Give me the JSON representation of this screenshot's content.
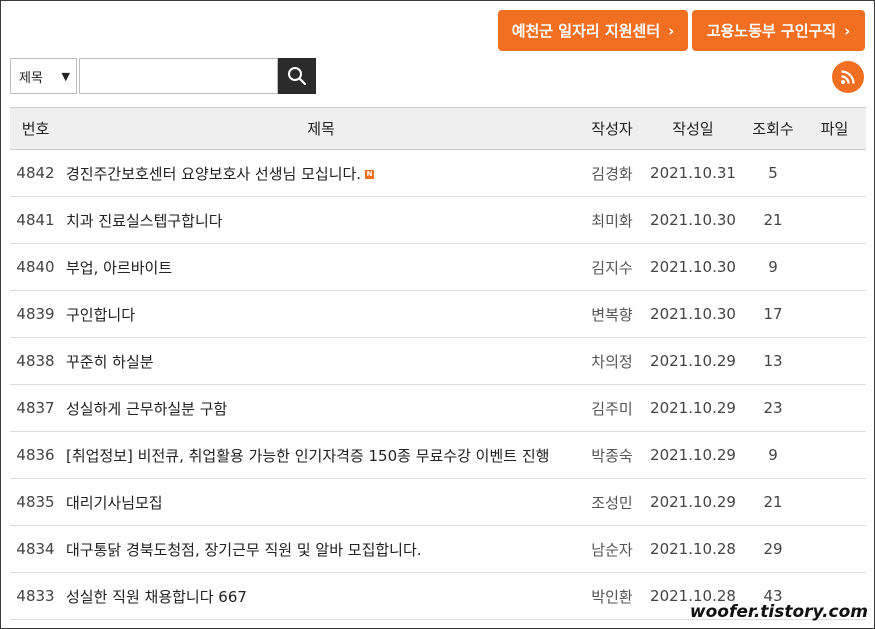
{
  "header": {
    "buttons": [
      {
        "label": "예천군 일자리 지원센터"
      },
      {
        "label": "고용노동부 구인구직"
      }
    ]
  },
  "search": {
    "select_value": "제목",
    "input_value": "",
    "search_icon": "search-icon",
    "rss_icon": "rss-icon"
  },
  "table": {
    "headers": {
      "num": "번호",
      "title": "제목",
      "author": "작성자",
      "date": "작성일",
      "views": "조회수",
      "file": "파일"
    },
    "rows": [
      {
        "num": "4842",
        "title": "경진주간보호센터 요양보호사 선생님 모십니다.",
        "author": "김경화",
        "date": "2021.10.31",
        "views": "5",
        "new": "N"
      },
      {
        "num": "4841",
        "title": "치과 진료실스텝구합니다",
        "author": "최미화",
        "date": "2021.10.30",
        "views": "21"
      },
      {
        "num": "4840",
        "title": "부업, 아르바이트",
        "author": "김지수",
        "date": "2021.10.30",
        "views": "9"
      },
      {
        "num": "4839",
        "title": "구인합니다",
        "author": "변복향",
        "date": "2021.10.30",
        "views": "17"
      },
      {
        "num": "4838",
        "title": "꾸준히 하실분",
        "author": "차의정",
        "date": "2021.10.29",
        "views": "13"
      },
      {
        "num": "4837",
        "title": "성실하게 근무하실분 구함",
        "author": "김주미",
        "date": "2021.10.29",
        "views": "23"
      },
      {
        "num": "4836",
        "title": "[취업정보] 비전큐, 취업활용 가능한 인기자격증 150종 무료수강 이벤트 진행",
        "author": "박종숙",
        "date": "2021.10.29",
        "views": "9"
      },
      {
        "num": "4835",
        "title": "대리기사님모집",
        "author": "조성민",
        "date": "2021.10.29",
        "views": "21"
      },
      {
        "num": "4834",
        "title": "대구통닭 경북도청점, 장기근무 직원 및 알바 모집합니다.",
        "author": "남순자",
        "date": "2021.10.28",
        "views": "29"
      },
      {
        "num": "4833",
        "title": "성실한 직원 채용합니다 667",
        "author": "박인환",
        "date": "2021.10.28",
        "views": "43"
      }
    ]
  },
  "watermark": "woofer.tistory.com",
  "colors": {
    "accent": "#f26f21",
    "search_button": "#2b2b2b",
    "header_bg": "#efefef"
  }
}
